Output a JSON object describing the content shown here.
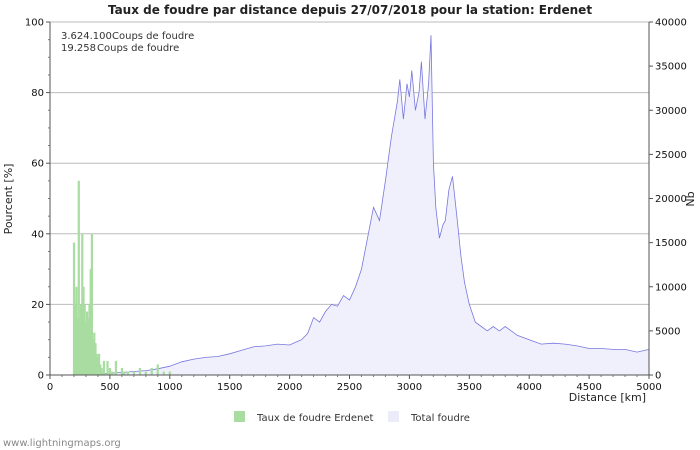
{
  "chart_data": {
    "type": "bar",
    "title": "Taux de foudre par distance depuis 27/07/2018 pour la station: Erdenet",
    "xlabel": "Distance   [km]",
    "ylabel": "Pourcent   [%]",
    "y2label": "Nb",
    "xlim": [
      0,
      5000
    ],
    "ylim": [
      0,
      100
    ],
    "y2lim": [
      0,
      40000
    ],
    "xticks": [
      0,
      500,
      1000,
      1500,
      2000,
      2500,
      3000,
      3500,
      4000,
      4500,
      5000
    ],
    "yticks": [
      0,
      20,
      40,
      60,
      80,
      100
    ],
    "y2ticks": [
      0,
      5000,
      10000,
      15000,
      20000,
      25000,
      30000,
      35000,
      40000
    ],
    "grid": true,
    "legend_position": "bottom",
    "series": [
      {
        "name": "Taux de foudre Erdenet",
        "kind": "bar",
        "axis": "left",
        "color": "#a8dca0",
        "x": [
          200,
          210,
          220,
          230,
          240,
          250,
          260,
          270,
          280,
          290,
          300,
          310,
          320,
          330,
          340,
          350,
          360,
          370,
          380,
          390,
          400,
          410,
          420,
          430,
          440,
          450,
          480,
          500,
          520,
          550,
          600,
          620,
          650,
          700,
          750,
          800,
          850,
          900,
          950,
          1000
        ],
        "values": [
          37.5,
          20,
          25,
          16,
          55,
          16,
          20,
          40,
          25,
          20,
          15,
          18,
          16,
          20,
          30,
          40,
          10,
          12,
          9,
          6,
          5,
          6,
          3,
          2,
          1,
          4,
          4,
          2,
          1,
          4,
          2,
          1,
          1,
          1,
          2,
          1,
          2,
          3,
          1,
          1
        ]
      },
      {
        "name": "Total foudre",
        "kind": "area",
        "axis": "right",
        "color": "#7777dd",
        "fill": "#f0f0fc",
        "x": [
          0,
          200,
          400,
          600,
          800,
          900,
          1000,
          1100,
          1200,
          1300,
          1400,
          1500,
          1600,
          1700,
          1800,
          1900,
          2000,
          2050,
          2100,
          2150,
          2200,
          2250,
          2300,
          2350,
          2400,
          2450,
          2500,
          2550,
          2600,
          2650,
          2700,
          2750,
          2800,
          2850,
          2900,
          2920,
          2950,
          2980,
          3000,
          3020,
          3050,
          3080,
          3100,
          3130,
          3160,
          3180,
          3200,
          3220,
          3250,
          3280,
          3300,
          3330,
          3360,
          3400,
          3430,
          3460,
          3500,
          3550,
          3600,
          3650,
          3700,
          3750,
          3800,
          3900,
          4000,
          4100,
          4200,
          4300,
          4400,
          4500,
          4600,
          4700,
          4800,
          4900,
          5000
        ],
        "values": [
          0,
          0,
          100,
          300,
          500,
          700,
          1000,
          1500,
          1800,
          2000,
          2100,
          2400,
          2800,
          3200,
          3300,
          3500,
          3400,
          3700,
          4000,
          4700,
          6500,
          6000,
          7200,
          8000,
          7800,
          9000,
          8500,
          10000,
          12000,
          15500,
          19000,
          17500,
          22000,
          27000,
          31000,
          33500,
          29000,
          33000,
          31500,
          34500,
          30000,
          32000,
          35500,
          29000,
          33000,
          38500,
          24000,
          19000,
          15500,
          17000,
          17500,
          21000,
          22500,
          17500,
          13500,
          10500,
          8000,
          6000,
          5500,
          5000,
          5500,
          5000,
          5500,
          4500,
          4000,
          3500,
          3600,
          3500,
          3300,
          3000,
          3000,
          2900,
          2900,
          2600,
          2900
        ]
      }
    ],
    "annotations": [
      {
        "value": "3.624.100",
        "label": "Coups de foudre"
      },
      {
        "value": "19.258",
        "label": "Coups de foudre"
      }
    ]
  },
  "footer": "www.lightningmaps.org"
}
